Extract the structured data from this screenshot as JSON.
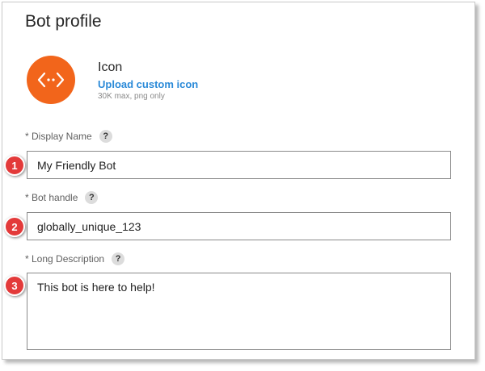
{
  "page": {
    "title": "Bot profile"
  },
  "icon_section": {
    "label": "Icon",
    "upload_link": "Upload custom icon",
    "hint": "30K max, png only",
    "icon_name": "code-brackets-icon",
    "icon_color": "#f2651b"
  },
  "fields": {
    "display_name": {
      "label": "* Display Name",
      "help": "?",
      "value": "My Friendly Bot"
    },
    "bot_handle": {
      "label": "* Bot handle",
      "help": "?",
      "value": "globally_unique_123"
    },
    "long_description": {
      "label": "* Long Description",
      "help": "?",
      "value": "This bot is here to help!"
    }
  },
  "callouts": [
    "1",
    "2",
    "3"
  ],
  "colors": {
    "link": "#2b8ad8",
    "callout": "#e33a3a",
    "input_border": "#8a8a8a"
  }
}
